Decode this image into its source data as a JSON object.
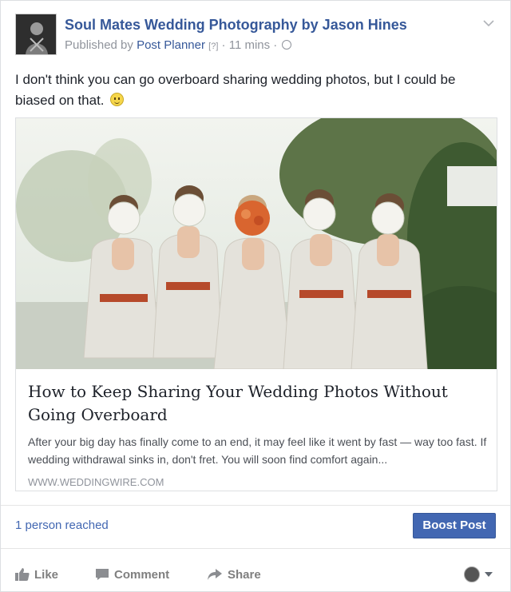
{
  "post": {
    "page_name": "Soul Mates Wedding Photography by Jason Hines",
    "published_by": "Published by",
    "publisher": "Post Planner",
    "help_marker": "[?]",
    "time_ago": "· 11 mins ·",
    "message": "I don't think you can go overboard sharing wedding photos, but I could be biased on that."
  },
  "link_preview": {
    "title": "How to Keep Sharing Your Wedding Photos Without Going Overboard",
    "description": "After your big day has finally come to an end, it may feel like it went by fast — way too fast. If wedding withdrawal sinks in, don't fret. You will soon find comfort again...",
    "domain": "WWW.WEDDINGWIRE.COM"
  },
  "insights": {
    "reach_text": "1 person reached",
    "boost_label": "Boost Post"
  },
  "actions": {
    "like": "Like",
    "comment": "Comment",
    "share": "Share"
  },
  "colors": {
    "link_blue": "#365899",
    "boost_bg": "#4267b2",
    "muted_gray": "#90949c"
  }
}
